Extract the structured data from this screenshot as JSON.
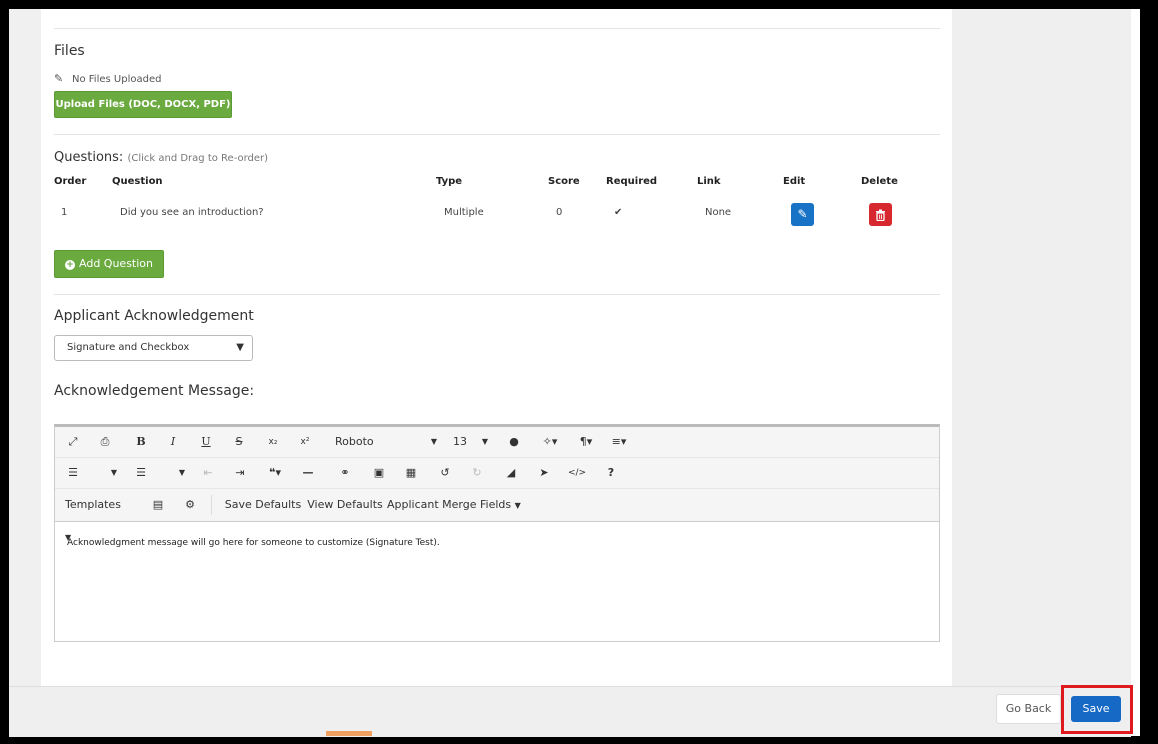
{
  "files": {
    "title": "Files",
    "no_files": "No Files Uploaded",
    "upload_label": "Upload Files (DOC, DOCX, PDF)"
  },
  "questions": {
    "title": "Questions:",
    "hint": "(Click and Drag to Re-order)",
    "headers": [
      "Order",
      "Question",
      "Type",
      "Score",
      "Required",
      "Link",
      "Edit",
      "Delete"
    ],
    "rows": [
      {
        "order": "1",
        "question": "Did you see an introduction?",
        "type": "Multiple",
        "score": "0",
        "required": "✔",
        "link": "None"
      }
    ],
    "add_label": "Add Question"
  },
  "acknowledgement": {
    "title": "Applicant Acknowledgement",
    "selected": "Signature and Checkbox",
    "message_title": "Acknowledgement Message:"
  },
  "editor": {
    "font": "Roboto",
    "size": "13",
    "templates_label": "Templates",
    "save_defaults": "Save Defaults",
    "view_defaults": "View Defaults",
    "merge_fields": "Applicant Merge Fields",
    "content": "Acknowledgment message will go here for someone to customize (Signature Test)."
  },
  "footer": {
    "go_back": "Go Back",
    "save": "Save"
  },
  "colors": {
    "green": "#6aaa3f",
    "blue": "#1669c4",
    "red": "#d7282f",
    "highlight": "#e0191f"
  }
}
